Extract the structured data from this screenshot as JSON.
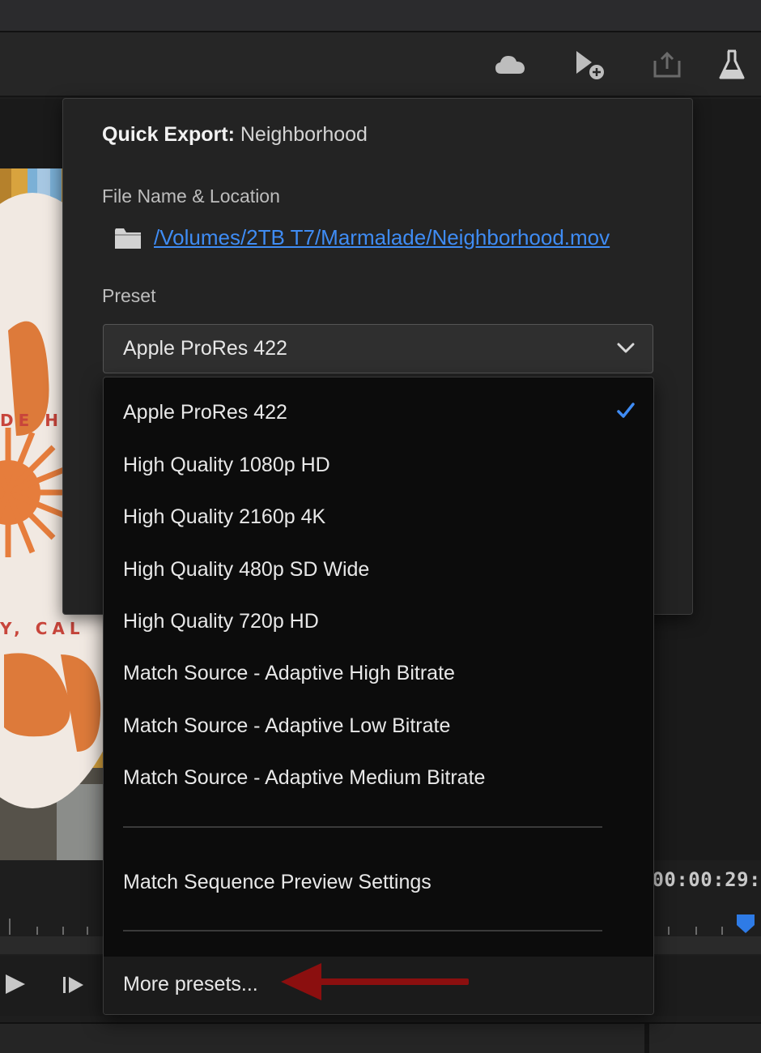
{
  "toolbar": {
    "icons": [
      "cloud-icon",
      "add-marker-icon",
      "share-export-icon",
      "beta-flask-icon"
    ]
  },
  "quick_export": {
    "title_bold": "Quick Export:",
    "title_name": "Neighborhood",
    "file_label": "File Name & Location",
    "file_path": "/Volumes/2TB T7/Marmalade/Neighborhood.mov",
    "preset_label": "Preset",
    "selected_preset": "Apple ProRes 422"
  },
  "preset_menu": {
    "items": [
      "Apple ProRes 422",
      "High Quality 1080p HD",
      "High Quality 2160p 4K",
      "High Quality 480p SD Wide",
      "High Quality 720p HD",
      "Match Source - Adaptive High Bitrate",
      "Match Source - Adaptive Low Bitrate",
      "Match Source - Adaptive Medium Bitrate"
    ],
    "sequence_item": "Match Sequence Preview Settings",
    "more_presets": "More presets..."
  },
  "monitor": {
    "timecode": "00:00:29:"
  },
  "colors": {
    "accent": "#3f8cf4",
    "arrow": "#8b0f0f",
    "menu_bg": "#0c0c0c",
    "panel_bg": "#232323"
  }
}
